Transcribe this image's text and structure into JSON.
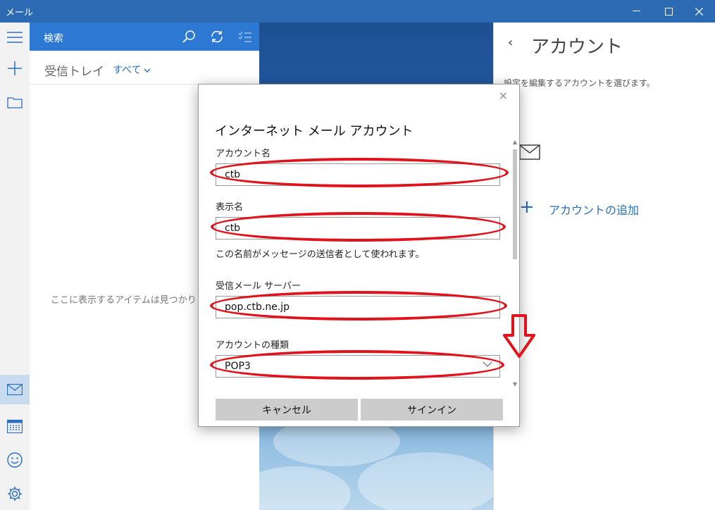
{
  "window": {
    "title": "メール",
    "controls": {
      "minimize": "—",
      "maximize": "☐",
      "close": "✕"
    }
  },
  "rail": {
    "icons": [
      "menu-icon",
      "compose-icon",
      "folder-icon",
      "mail-icon",
      "calendar-icon",
      "smiley-icon",
      "settings-icon"
    ]
  },
  "searchbar": {
    "label": "検索"
  },
  "inbox": {
    "title": "受信トレイ",
    "filter": "すべて"
  },
  "list": {
    "empty_message": "ここに表示するアイテムは見つかりませ"
  },
  "accounts": {
    "back": "‹",
    "title": "アカウント",
    "description": "設定を編集するアカウントを選びます。",
    "add_icon": "+",
    "add_label": "アカウントの追加"
  },
  "dialog": {
    "close": "×",
    "title": "インターネット メール アカウント",
    "account_name_label": "アカウント名",
    "account_name_value": "ctb",
    "display_name_label": "表示名",
    "display_name_value": "ctb",
    "display_name_hint": "この名前がメッセージの送信者として使われます。",
    "incoming_server_label": "受信メール サーバー",
    "incoming_server_value": "pop.ctb.ne.jp",
    "account_type_label": "アカウントの種類",
    "account_type_value": "POP3",
    "cancel_label": "キャンセル",
    "signin_label": "サインイン"
  },
  "colors": {
    "accent": "#2c78d2",
    "titlebar": "#2c6bb4",
    "highlight": "#e0121b"
  }
}
